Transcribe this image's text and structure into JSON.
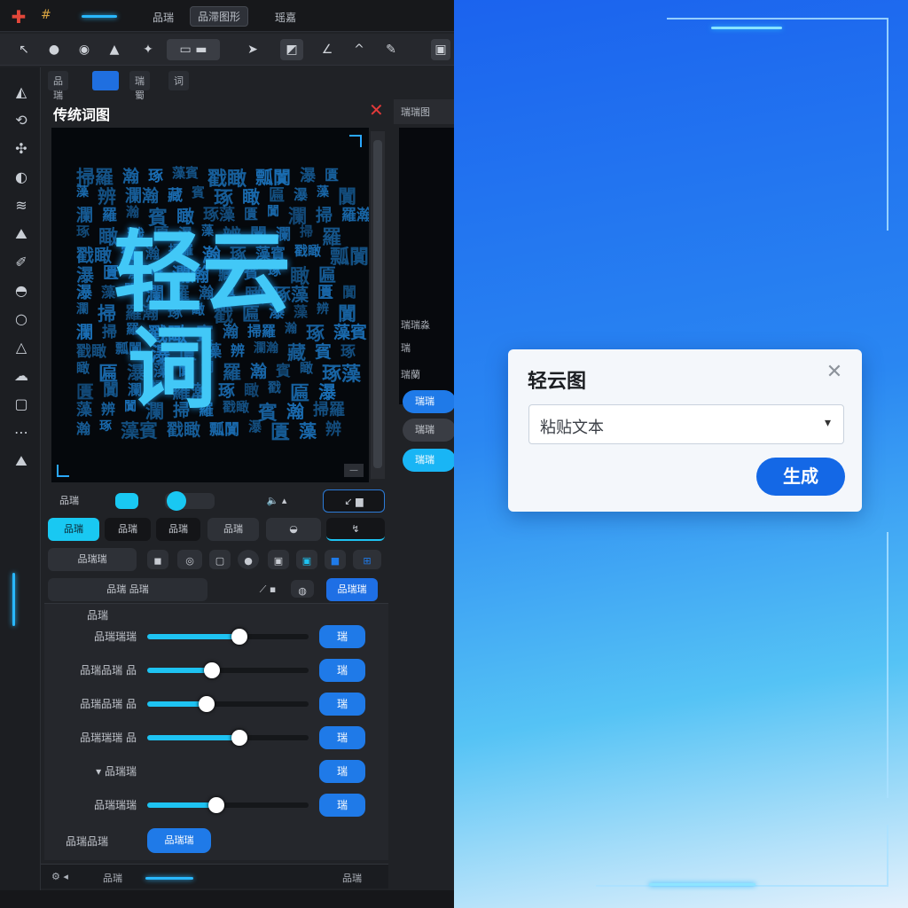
{
  "editor": {
    "menu": [
      "品瑞",
      "品滞图形",
      "瑶嘉"
    ],
    "tabs": [
      "品瑞",
      "",
      "瑞蜀",
      "词"
    ],
    "panel_title": "传统词图",
    "close_glyph": "✕",
    "canvas_badge": "—",
    "wordcloud": {
      "big_words": [
        "轻云",
        "词"
      ],
      "small_words": [
        "掃羅",
        "瀚",
        "琢",
        "藻賓",
        "戳瞰",
        "瓢闐",
        "瀑",
        "匱",
        "藻",
        "辨",
        "瀾瀚",
        "藏",
        "賓",
        "琢",
        "瞰",
        "匾",
        "瀑",
        "藻",
        "闐",
        "瀾",
        "羅",
        "瀚",
        "賓",
        "瞰",
        "琢藻",
        "匱",
        "闐",
        "瀾",
        "掃",
        "羅瀚",
        "琢",
        "瞰",
        "戳",
        "匾",
        "瀑",
        "藻",
        "辨",
        "闐",
        "瀾",
        "掃",
        "羅",
        "戳瞰",
        "賓",
        "瀚"
      ]
    },
    "right_col": {
      "header": "瑞瑞图",
      "rows": [
        "瑞瑞淼",
        "瑞",
        "瑞蘭"
      ],
      "buttons": [
        "瑞瑞",
        "瑞瑞",
        "瑞瑞"
      ]
    },
    "controls": {
      "row1_label": "品瑞",
      "row2": [
        "品瑞",
        "品瑞",
        "品瑞",
        "品瑞",
        "",
        ""
      ],
      "row3_label": "品瑞瑞",
      "row4_label": "品瑞 品瑞",
      "row4_btn": "品瑞瑞"
    },
    "sliders_header": "品瑞",
    "sliders": [
      {
        "label": "品瑞瑞瑞",
        "value": 0.57,
        "btn": "瑞"
      },
      {
        "label": "品瑞品瑞 品",
        "value": 0.4,
        "btn": "瑞"
      },
      {
        "label": "品瑞品瑞 品",
        "value": 0.37,
        "btn": "瑞"
      },
      {
        "label": "品瑞瑞瑞 品",
        "value": 0.57,
        "btn": "瑞"
      },
      {
        "label": "▾ 品瑞瑞",
        "value": null,
        "btn": "瑞"
      },
      {
        "label": "品瑞瑞瑞",
        "value": 0.43,
        "btn": "瑞"
      }
    ],
    "bottom_label": "品瑞品瑞",
    "bottom_btn": "品瑞瑞",
    "status": [
      "品瑞",
      "品瑞"
    ]
  },
  "dialog": {
    "title": "轻云图",
    "close_glyph": "✕",
    "select_value": "粘贴文本",
    "chevron": "▾",
    "generate_label": "生成"
  },
  "colors": {
    "accent_cyan": "#19c8f2",
    "accent_blue": "#1f7ae8",
    "dialog_primary": "#1468e6"
  }
}
